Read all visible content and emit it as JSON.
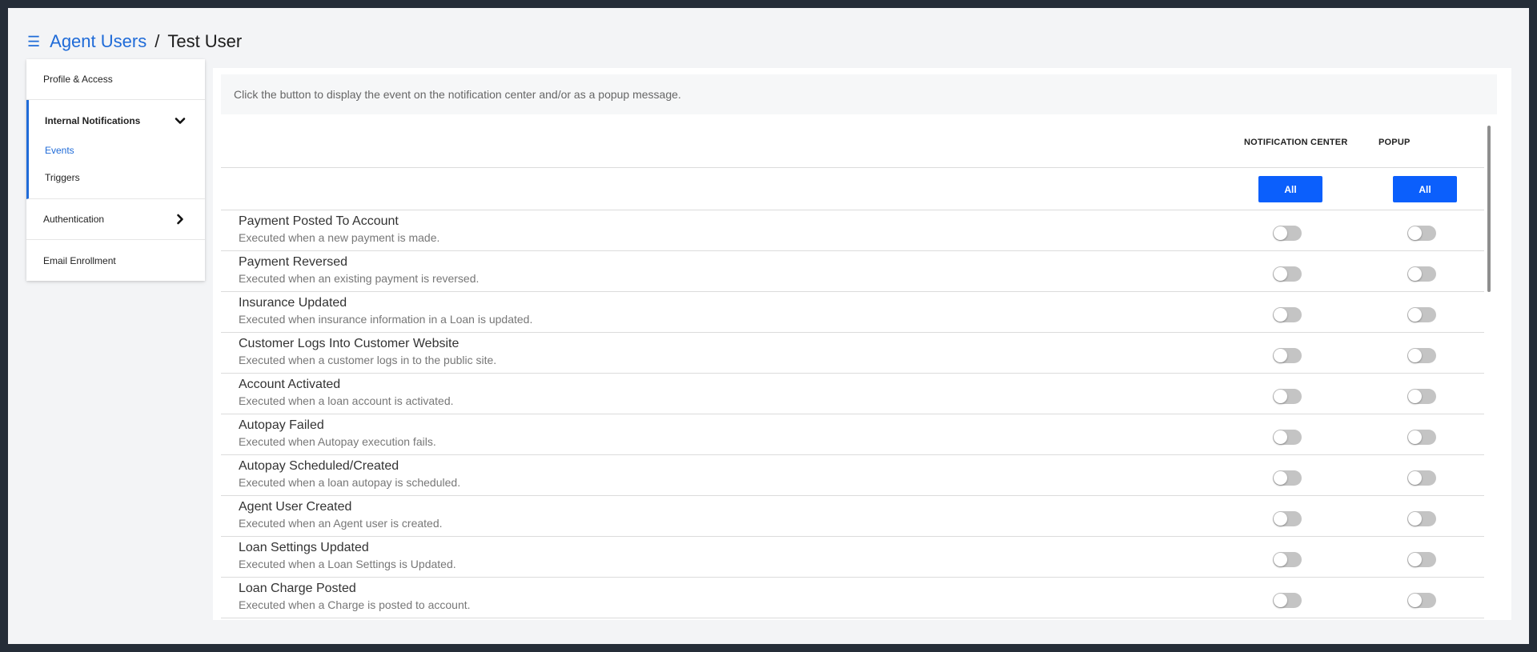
{
  "header": {
    "menu_icon": "☰",
    "breadcrumb_link": "Agent Users",
    "separator": "/",
    "current": "Test User"
  },
  "sidebar": {
    "items": [
      {
        "label": "Profile & Access"
      },
      {
        "label": "Internal Notifications",
        "expanded": true,
        "children": [
          {
            "label": "Events",
            "active": true
          },
          {
            "label": "Triggers"
          }
        ]
      },
      {
        "label": "Authentication"
      },
      {
        "label": "Email Enrollment"
      }
    ]
  },
  "panel": {
    "info": "Click the button to display the event on the notification center and/or as a popup message.",
    "columns": {
      "notification_center": "NOTIFICATION CENTER",
      "popup": "POPUP"
    },
    "all_label": "All",
    "events": [
      {
        "title": "Payment Posted To Account",
        "desc": "Executed when a new payment is made.",
        "nc": false,
        "popup": false
      },
      {
        "title": "Payment Reversed",
        "desc": "Executed when an existing payment is reversed.",
        "nc": false,
        "popup": false
      },
      {
        "title": "Insurance Updated",
        "desc": "Executed when insurance information in a Loan is updated.",
        "nc": false,
        "popup": false
      },
      {
        "title": "Customer Logs Into Customer Website",
        "desc": "Executed when a customer logs in to the public site.",
        "nc": false,
        "popup": false
      },
      {
        "title": "Account Activated",
        "desc": "Executed when a loan account is activated.",
        "nc": false,
        "popup": false
      },
      {
        "title": "Autopay Failed",
        "desc": "Executed when Autopay execution fails.",
        "nc": false,
        "popup": false
      },
      {
        "title": "Autopay Scheduled/Created",
        "desc": "Executed when a loan autopay is scheduled.",
        "nc": false,
        "popup": false
      },
      {
        "title": "Agent User Created",
        "desc": "Executed when an Agent user is created.",
        "nc": false,
        "popup": false
      },
      {
        "title": "Loan Settings Updated",
        "desc": "Executed when a Loan Settings is Updated.",
        "nc": false,
        "popup": false
      },
      {
        "title": "Loan Charge Posted",
        "desc": "Executed when a Charge is posted to account.",
        "nc": false,
        "popup": false
      }
    ]
  },
  "colors": {
    "accent": "#1f6bd8",
    "button": "#0b5ffc",
    "toggle_off": "#c4c4c4"
  }
}
